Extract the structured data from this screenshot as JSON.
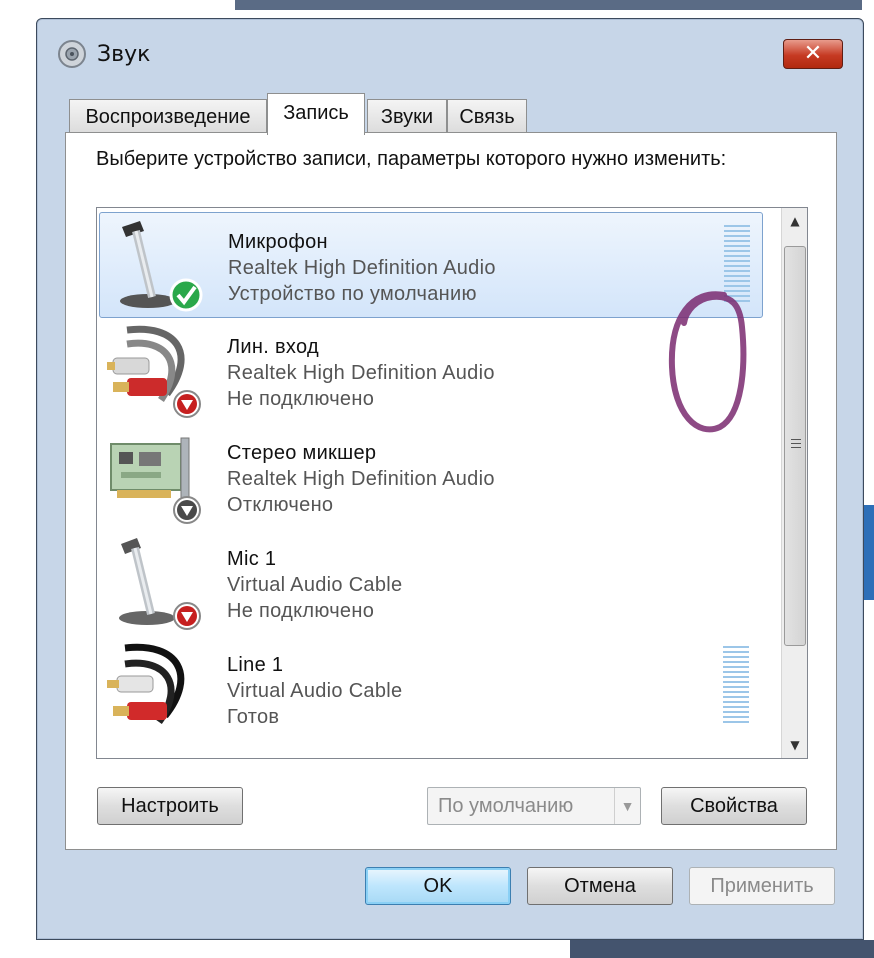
{
  "window": {
    "title": "Звук",
    "close_label": "✕"
  },
  "tabs": [
    {
      "label": "Воспроизведение",
      "active": false
    },
    {
      "label": "Запись",
      "active": true
    },
    {
      "label": "Звуки",
      "active": false
    },
    {
      "label": "Связь",
      "active": false
    }
  ],
  "panel": {
    "instruction": "Выберите устройство записи, параметры которого нужно изменить:"
  },
  "devices": [
    {
      "name": "Микрофон",
      "driver": "Realtek High Definition Audio",
      "status": "Устройство по умолчанию",
      "icon": "microphone-default-icon",
      "selected": true
    },
    {
      "name": "Лин. вход",
      "driver": "Realtek High Definition Audio",
      "status": "Не подключено",
      "icon": "line-in-cable-icon",
      "selected": false
    },
    {
      "name": "Стерео микшер",
      "driver": "Realtek High Definition Audio",
      "status": "Отключено",
      "icon": "sound-card-icon",
      "selected": false
    },
    {
      "name": "Mic 1",
      "driver": "Virtual Audio Cable",
      "status": "Не подключено",
      "icon": "microphone-icon",
      "selected": false
    },
    {
      "name": "Line 1",
      "driver": "Virtual Audio Cable",
      "status": "Готов",
      "icon": "line-cable-icon",
      "selected": false
    }
  ],
  "buttons": {
    "configure": "Настроить",
    "default_select": "По умолчанию",
    "properties": "Свойства",
    "ok": "OK",
    "cancel": "Отмена",
    "apply": "Применить"
  },
  "scrollbar": {
    "up_glyph": "▲",
    "down_glyph": "▼"
  },
  "colors": {
    "selection": "#d3e5fa",
    "selection_border": "#7da2ce",
    "level_meter": "#9cc6e8",
    "annotation": "#7a2a70"
  }
}
